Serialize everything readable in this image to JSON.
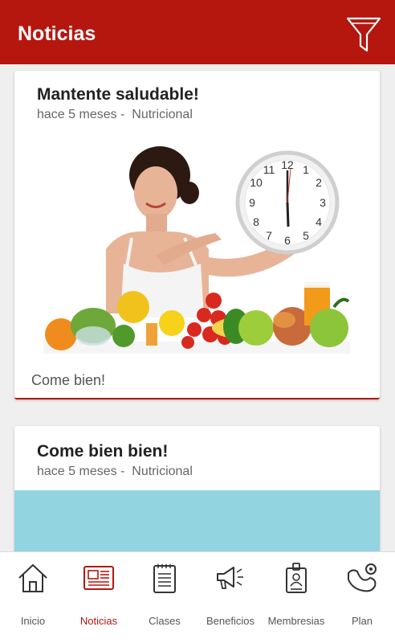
{
  "app_bar": {
    "title": "Noticias",
    "filter_icon": "funnel-icon"
  },
  "colors": {
    "primary": "#b5170f",
    "background": "#efefef",
    "card": "#ffffff",
    "placeholder_image": "#93d4e1"
  },
  "news": [
    {
      "title": "Mantente saludable!",
      "time": "hace 5 meses - ",
      "category": "Nutricional",
      "body": "Come bien!",
      "image": "woman-with-clock-and-fruits"
    },
    {
      "title": "Come bien bien!",
      "time": "hace 5 meses - ",
      "category": "Nutricional",
      "image": "teal-image"
    }
  ],
  "bottom_nav": [
    {
      "label": "Inicio",
      "icon": "home-icon",
      "active": false
    },
    {
      "label": "Noticias",
      "icon": "newspaper-icon",
      "active": true
    },
    {
      "label": "Clases",
      "icon": "clipboard-icon",
      "active": false
    },
    {
      "label": "Beneficios",
      "icon": "megaphone-icon",
      "active": false
    },
    {
      "label": "Membresias",
      "icon": "id-badge-icon",
      "active": false
    },
    {
      "label": "Plan",
      "icon": "muscle-arm-icon",
      "active": false
    }
  ]
}
